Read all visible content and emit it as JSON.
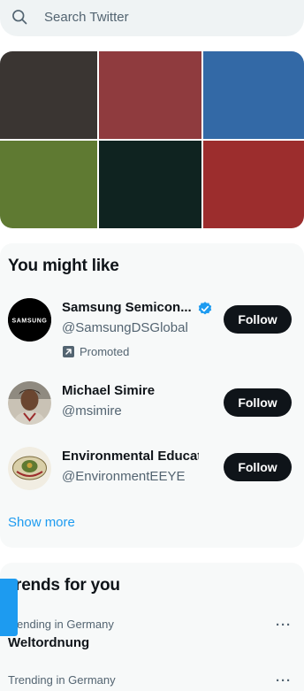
{
  "search": {
    "placeholder": "Search Twitter",
    "icon": "search-icon"
  },
  "media_grid": {
    "tiles": [
      {
        "color": "#3a3532"
      },
      {
        "color": "#8f3b3e"
      },
      {
        "color": "#3369a6"
      },
      {
        "color": "#5f7a32"
      },
      {
        "color": "#0f2320"
      },
      {
        "color": "#9c2d2d"
      }
    ]
  },
  "who_to_follow": {
    "title": "You might like",
    "users": [
      {
        "name": "Samsung Semicon...",
        "handle": "@SamsungDSGlobal",
        "verified": true,
        "promoted_label": "Promoted",
        "follow_label": "Follow",
        "avatar_text": "SAMSUNG"
      },
      {
        "name": "Michael Simire",
        "handle": "@msimire",
        "follow_label": "Follow"
      },
      {
        "name": "Environmental Educat...",
        "handle": "@EnvironmentEEYE",
        "follow_label": "Follow"
      }
    ],
    "show_more": "Show more"
  },
  "trends": {
    "title": "rends for you",
    "items": [
      {
        "meta": "ending in Germany",
        "name": "Weltordnung"
      },
      {
        "meta": "Trending in Germany",
        "name": ""
      }
    ]
  },
  "colors": {
    "accent": "#1d9bf0",
    "text": "#0f1419",
    "muted": "#536471",
    "card_bg": "#f7f9f9"
  }
}
